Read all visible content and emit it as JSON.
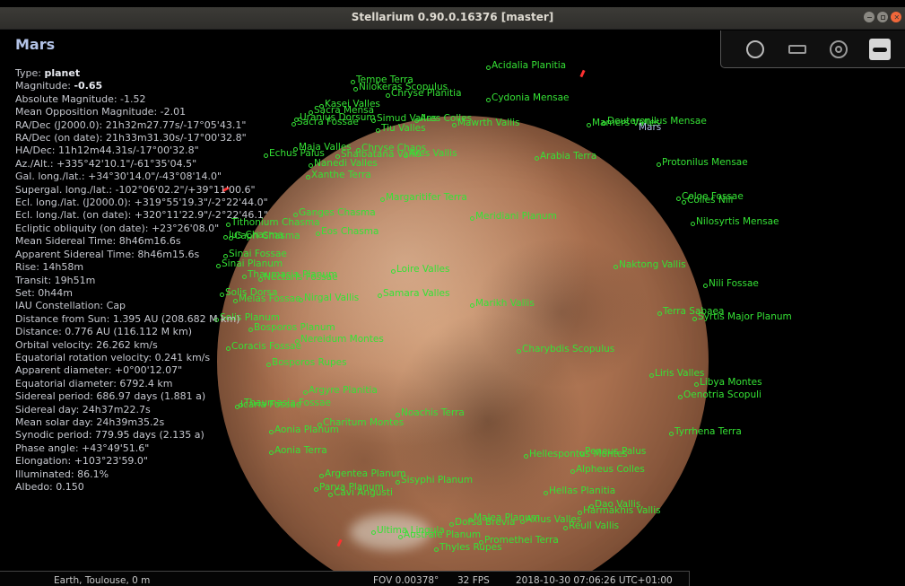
{
  "window": {
    "title": "Stellarium 0.90.0.16376 [master]"
  },
  "object": {
    "name": "Mars",
    "lines": [
      {
        "label": "Type: ",
        "value": "planet"
      },
      {
        "label": "Magnitude: ",
        "value": "-0.65"
      },
      {
        "label": "Absolute Magnitude: -1.52",
        "value": ""
      },
      {
        "label": "Mean Opposition Magnitude: -2.01",
        "value": ""
      },
      {
        "label": "RA/Dec (J2000.0): 21h32m27.77s/-17°05'43.1\"",
        "value": ""
      },
      {
        "label": "RA/Dec (on date): 21h33m31.30s/-17°00'32.8\"",
        "value": ""
      },
      {
        "label": "HA/Dec: 11h12m44.31s/-17°00'32.8\"",
        "value": ""
      },
      {
        "label": "Az./Alt.: +335°42'10.1\"/-61°35'04.5\"",
        "value": ""
      },
      {
        "label": "Gal. long./lat.: +34°30'14.0\"/-43°08'14.0\"",
        "value": ""
      },
      {
        "label": "Supergal. long./lat.: -102°06'02.2\"/+39°11'00.6\"",
        "value": ""
      },
      {
        "label": "Ecl. long./lat. (J2000.0): +319°55'19.3\"/-2°22'44.0\"",
        "value": ""
      },
      {
        "label": "Ecl. long./lat. (on date): +320°11'22.9\"/-2°22'46.1\"",
        "value": ""
      },
      {
        "label": "Ecliptic obliquity (on date): +23°26'08.0\"",
        "value": ""
      },
      {
        "label": "Mean Sidereal Time: 8h46m16.6s",
        "value": ""
      },
      {
        "label": "Apparent Sidereal Time: 8h46m15.6s",
        "value": ""
      },
      {
        "label": "Rise: 14h58m",
        "value": ""
      },
      {
        "label": "Transit: 19h51m",
        "value": ""
      },
      {
        "label": "Set: 0h44m",
        "value": ""
      },
      {
        "label": "IAU Constellation: Cap",
        "value": ""
      },
      {
        "label": "Distance from Sun: 1.395 AU (208.682 M km)",
        "value": ""
      },
      {
        "label": "Distance: 0.776 AU (116.112 M km)",
        "value": ""
      },
      {
        "label": "Orbital velocity: 26.262 km/s",
        "value": ""
      },
      {
        "label": "Equatorial rotation velocity: 0.241 km/s",
        "value": ""
      },
      {
        "label": "Apparent diameter: +0°00'12.07\"",
        "value": ""
      },
      {
        "label": "Equatorial diameter: 6792.4 km",
        "value": ""
      },
      {
        "label": "Sidereal period: 686.97 days (1.881 a)",
        "value": ""
      },
      {
        "label": "Sidereal day: 24h37m22.7s",
        "value": ""
      },
      {
        "label": "Mean solar day: 24h39m35.2s",
        "value": ""
      },
      {
        "label": "Synodic period: 779.95 days (2.135 a)",
        "value": ""
      },
      {
        "label": "Phase angle: +43°49'51.6\"",
        "value": ""
      },
      {
        "label": "Elongation: +103°23'59.0\"",
        "value": ""
      },
      {
        "label": "Illuminated: 86.1%",
        "value": ""
      },
      {
        "label": "Albedo: 0.150",
        "value": ""
      }
    ]
  },
  "planet_label": "Mars",
  "features": [
    "Acidalia Planitia",
    "Tempe Terra",
    "Nilokeras Scopulus",
    "Chryse Planitia",
    "Cydonia Mensae",
    "Kasei Valles",
    "Sacra Mensa",
    "Uranius Dorsum",
    "Simud Valles",
    "Sacra Fossae",
    "Ares Colles",
    "Mawrth Vallis",
    "Tiu Valles",
    "Mamers Valles",
    "Deuteronilus Mensae",
    "Echus Palus",
    "Maja Valles",
    "Chryse Chaos",
    "Shalbatana Vallis",
    "Ares Vallis",
    "Arabia Terra",
    "Nanedi Valles",
    "Xanthe Terra",
    "Protonilus Mensae",
    "Margaritifer Terra",
    "Coloe Fossae",
    "Colles Nili",
    "Ganges Chasma",
    "Meridiani Planum",
    "Nilosyrtis Mensae",
    "Tithonium Chasma",
    "Eos Chasma",
    "Ius Chasma",
    "Capri Chasma",
    "Sinai Fossae",
    "Sinai Planum",
    "Loire Valles",
    "Naktong Vallis",
    "Thaumasia Planum",
    "Nectaris Fossae",
    "Nili Fossae",
    "Solis Dorsa",
    "Samara Valles",
    "Melas Fossae",
    "Nirgal Vallis",
    "Marikh Vallis",
    "Terra Sabaea",
    "Solis Planum",
    "Syrtis Major Planum",
    "Bosporos Planum",
    "Nereidum Montes",
    "Coracis Fossae",
    "Charybdis Scopulus",
    "Bosporos Rupes",
    "Liris Valles",
    "Libya Montes",
    "Oenotria Scopuli",
    "Argyre Planitia",
    "Icaria Fossae",
    "Thaumasia Fossae",
    "Noachis Terra",
    "Charitum Montes",
    "Aonia Planum",
    "Tyrrhena Terra",
    "Aonia Terra",
    "Hellespontus Montes",
    "Peneus Palus",
    "Alpheus Colles",
    "Argentea Planum",
    "Sisyphi Planum",
    "Parva Planum",
    "Cavi Angusti",
    "Hellas Planitia",
    "Dao Vallis",
    "Harmakhis Vallis",
    "Malea Planum",
    "Dorsa Brevia",
    "Axius Valles",
    "Reull Vallis",
    "Ultima Lingula",
    "Promethei Terra",
    "Thyles Rupes",
    "Australe Planum"
  ],
  "statusbar": {
    "location": "Earth, Toulouse, 0 m",
    "fov": "FOV 0.00378°",
    "fps": "32 FPS",
    "datetime": "2018-10-30 07:06:26 UTC+01:00"
  }
}
